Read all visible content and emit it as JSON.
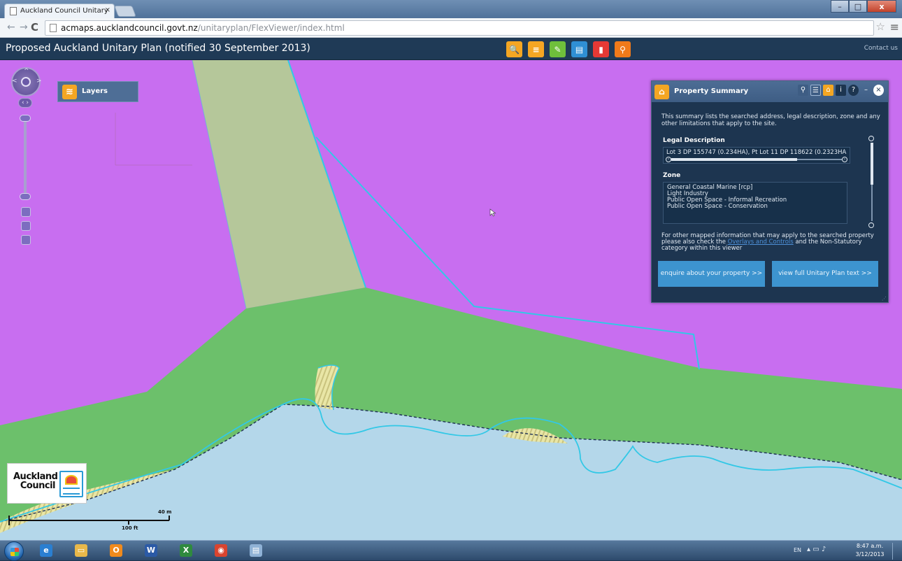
{
  "browser": {
    "tab_title": "Auckland Council Unitary",
    "tab_close": "×",
    "url_host": "acmaps.aucklandcouncil.govt.nz",
    "url_path": "/unitaryplan/FlexViewer/index.html",
    "window_minimize": "–",
    "window_maximize": "□",
    "window_close": "x"
  },
  "app": {
    "title": "Proposed Auckland Unitary Plan (notified 30 September 2013)",
    "contact_label": "Contact us",
    "tools": [
      {
        "name": "search-tool",
        "color": "#f4a623",
        "glyph": "🔍"
      },
      {
        "name": "layers-tool",
        "color": "#f4a623",
        "glyph": "≡"
      },
      {
        "name": "draw-tool",
        "color": "#6fbf3b",
        "glyph": "✎"
      },
      {
        "name": "print-tool",
        "color": "#2f8fd4",
        "glyph": "▤"
      },
      {
        "name": "bookmark-tool",
        "color": "#e53935",
        "glyph": "▮"
      },
      {
        "name": "locate-tool",
        "color": "#f07a1a",
        "glyph": "⚲"
      }
    ]
  },
  "map": {
    "layers_label": "Layers",
    "scale_m": "40 m",
    "scale_ft": "100 ft",
    "logo_line1": "Auckland",
    "logo_line2": "Council",
    "zone_colors": {
      "coastal_marine": "#c86ef0",
      "light_industry": "#b5c79a",
      "open_space_informal": "#6cc06b",
      "water": "#b4d7ea",
      "open_space_conservation": "#e9e6a6",
      "boundary": "#32c8e6"
    }
  },
  "panel": {
    "title": "Property Summary",
    "intro": "This summary lists the searched address, legal description, zone and any other limitations that apply to the site.",
    "legal_heading": "Legal Description",
    "legal_text": "Lot 3 DP 155747 (0.234HA), Pt Lot 11 DP 118622 (0.2323HA",
    "zone_heading": "Zone",
    "zones": [
      "General Coastal Marine [rcp]",
      "Light Industry",
      "Public Open Space - Informal Recreation",
      "Public Open Space - Conservation"
    ],
    "note_before": "For other mapped information that may apply to the searched property please also check the",
    "note_link": "Overlays and Controls",
    "note_after": "and the Non-Statutory category within this viewer",
    "enquire_button": "enquire about your property >>",
    "fulltext_button": "view full Unitary Plan text >>"
  },
  "taskbar": {
    "lang": "EN",
    "time": "8:47 a.m.",
    "date": "3/12/2013",
    "apps": [
      {
        "name": "ie",
        "color": "#2a7fd1",
        "glyph": "e"
      },
      {
        "name": "explorer",
        "color": "#e8b84a",
        "glyph": "▭"
      },
      {
        "name": "outlook",
        "color": "#f08a1c",
        "glyph": "O"
      },
      {
        "name": "word",
        "color": "#2b5aa6",
        "glyph": "W"
      },
      {
        "name": "excel",
        "color": "#2f8a3e",
        "glyph": "X"
      },
      {
        "name": "chrome",
        "color": "#d9442f",
        "glyph": "◉"
      },
      {
        "name": "notepad",
        "color": "#8fb2d6",
        "glyph": "▤"
      }
    ]
  }
}
